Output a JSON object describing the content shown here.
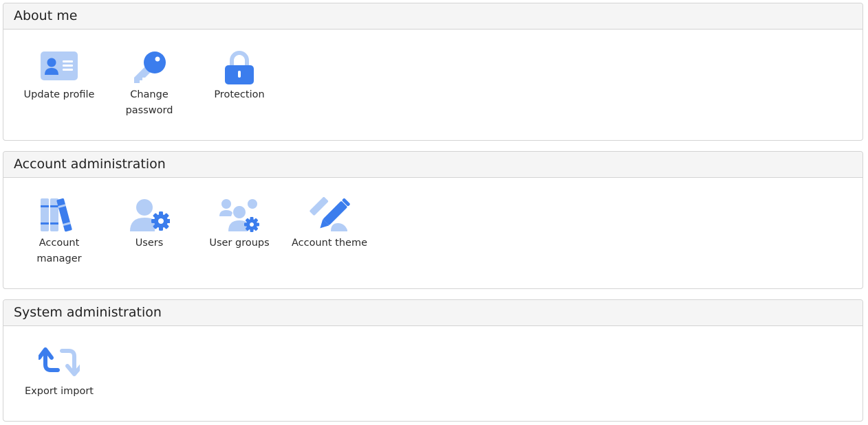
{
  "sections": [
    {
      "title": "About me",
      "items": [
        {
          "label": "Update profile",
          "icon": "id-card-icon"
        },
        {
          "label": "Change password",
          "icon": "key-icon"
        },
        {
          "label": "Protection",
          "icon": "lock-icon"
        }
      ]
    },
    {
      "title": "Account administration",
      "items": [
        {
          "label": "Account manager",
          "icon": "books-icon"
        },
        {
          "label": "Users",
          "icon": "user-gear-icon"
        },
        {
          "label": "User groups",
          "icon": "users-gear-icon"
        },
        {
          "label": "Account theme",
          "icon": "pen-paint-icon"
        }
      ]
    },
    {
      "title": "System administration",
      "items": [
        {
          "label": "Export import",
          "icon": "arrows-repeat-icon"
        }
      ]
    }
  ],
  "colors": {
    "icon_primary": "#3b7ded",
    "icon_secondary": "#b3cdf6",
    "header_bg": "#f5f5f5",
    "border": "#d3d3d3"
  }
}
